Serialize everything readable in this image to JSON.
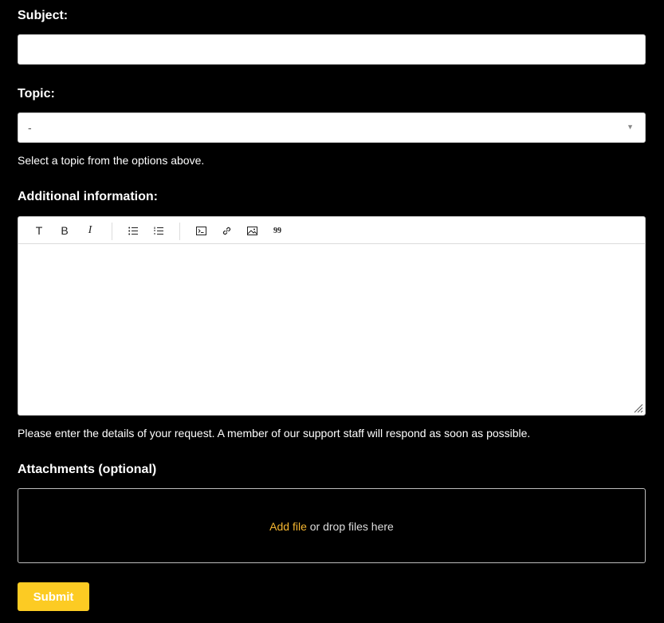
{
  "subject": {
    "label": "Subject:",
    "value": "",
    "placeholder": ""
  },
  "topic": {
    "label": "Topic:",
    "selected": "-",
    "hint": "Select a topic from the options above."
  },
  "additional_info": {
    "label": "Additional information:",
    "toolbar": {
      "groups": [
        [
          {
            "name": "text-style",
            "icon": "text-icon",
            "glyph": "T"
          },
          {
            "name": "bold",
            "icon": "bold-icon",
            "glyph": "B"
          },
          {
            "name": "italic",
            "icon": "italic-icon",
            "glyph": "I"
          }
        ],
        [
          {
            "name": "bulleted-list",
            "icon": "bulleted-list-icon"
          },
          {
            "name": "numbered-list",
            "icon": "numbered-list-icon"
          }
        ],
        [
          {
            "name": "code-block",
            "icon": "code-block-icon"
          },
          {
            "name": "link",
            "icon": "link-icon"
          },
          {
            "name": "image",
            "icon": "image-icon"
          },
          {
            "name": "quote",
            "icon": "quote-icon",
            "glyph": "99"
          }
        ]
      ]
    },
    "content": "",
    "hint": "Please enter the details of your request. A member of our support staff will respond as soon as possible."
  },
  "attachments": {
    "label": "Attachments (optional)",
    "add_file_label": "Add file",
    "drop_text": " or drop files here"
  },
  "submit": {
    "label": "Submit"
  },
  "colors": {
    "background": "#000000",
    "accent_button": "#fccb23",
    "link": "#f5b630",
    "input_border": "#c8c8c8"
  }
}
